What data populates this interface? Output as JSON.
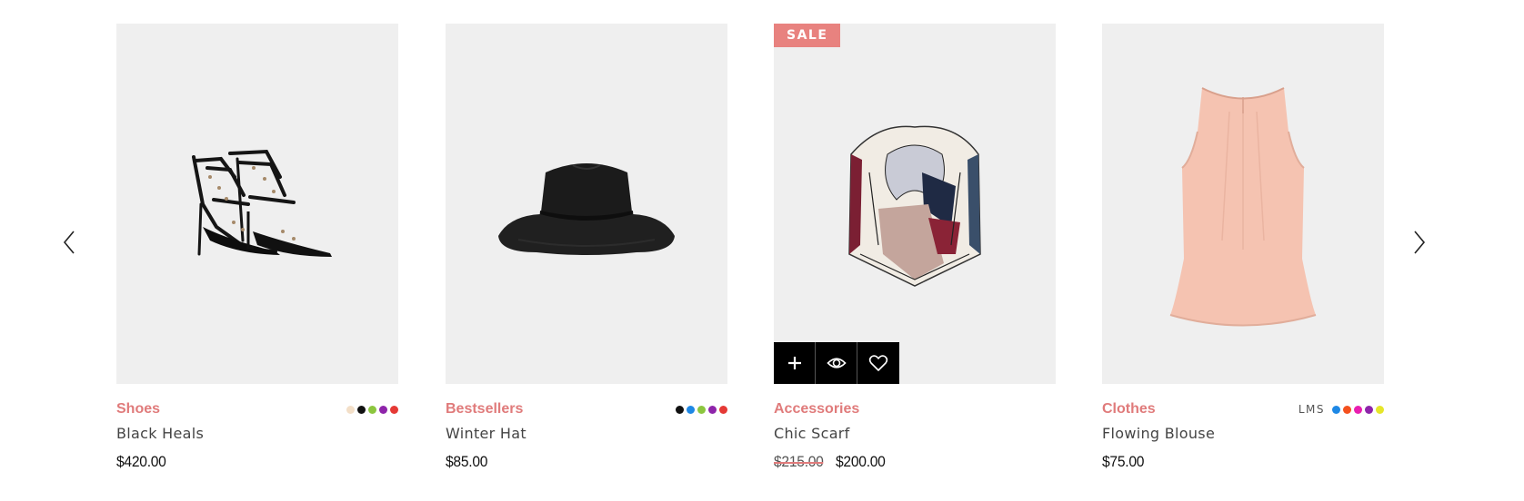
{
  "colors": {
    "accent": "#e07b7b",
    "sale_badge": "#e8827f",
    "thumb_bg": "#efefef"
  },
  "carousel": {
    "prev_icon": "chevron-left-icon",
    "next_icon": "chevron-right-icon"
  },
  "products": [
    {
      "category": "Shoes",
      "name": "Black Heals",
      "price": "$420.00",
      "sizes": "",
      "swatches": [
        "#f3dfc8",
        "#111111",
        "#8cc63f",
        "#8e24aa",
        "#e53935"
      ]
    },
    {
      "category": "Bestsellers",
      "name": "Winter Hat",
      "price": "$85.00",
      "sizes": "",
      "swatches": [
        "#111111",
        "#1e88e5",
        "#8cc63f",
        "#8e24aa",
        "#e53935"
      ]
    },
    {
      "category": "Accessories",
      "name": "Chic Scarf",
      "badge": "SALE",
      "price_old": "$215.00",
      "price": "$200.00",
      "sizes": "",
      "swatches": [],
      "actions": [
        {
          "icon": "plus-icon",
          "label": "+"
        },
        {
          "icon": "eye-icon",
          "label": "quick view"
        },
        {
          "icon": "heart-icon",
          "label": "wishlist"
        }
      ]
    },
    {
      "category": "Clothes",
      "name": "Flowing Blouse",
      "price": "$75.00",
      "sizes": "LMS",
      "swatches": [
        "#1e88e5",
        "#f4511e",
        "#e91eb0",
        "#8e24aa",
        "#e6e62a"
      ]
    }
  ]
}
